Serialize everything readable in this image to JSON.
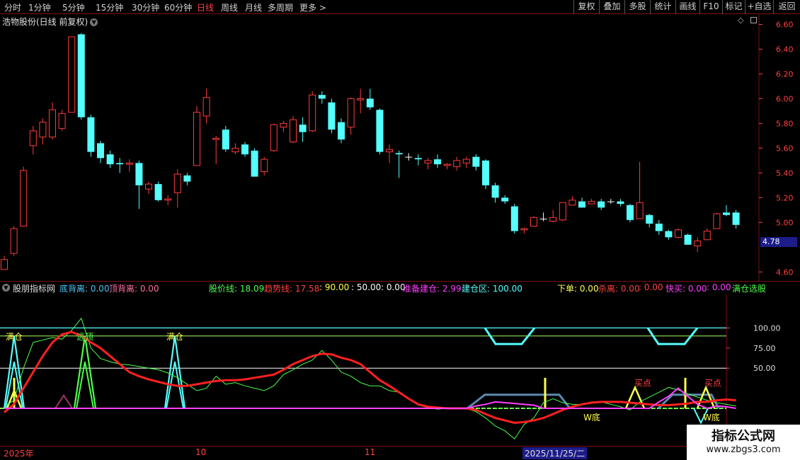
{
  "toolbar": {
    "periods": [
      "分时",
      "1分钟",
      "5分钟",
      "15分钟",
      "30分钟",
      "60分钟",
      "日线",
      "周线",
      "月线",
      "多周期",
      "更多 >"
    ],
    "active_period": "日线",
    "buttons": [
      "复权",
      "叠加",
      "多股",
      "统计",
      "画线",
      "F10",
      "标记",
      "+自选",
      "返回"
    ]
  },
  "main_chart": {
    "title": "浩物股份(日线 前复权)",
    "price_ticks": [
      "6.60",
      "6.40",
      "6.20",
      "6.00",
      "5.80",
      "5.60",
      "5.40",
      "5.20",
      "5.00",
      "4.60"
    ],
    "current_price": "4.78",
    "colors": {
      "up": "#ff3b3b",
      "down": "#54ffff",
      "flat": "#ffffff"
    }
  },
  "chart_data": [
    {
      "type": "candlestick",
      "title": "浩物股份(日线 前复权)",
      "ylim": [
        4.55,
        6.66
      ],
      "x": [
        "2025年",
        "10",
        "11",
        "2025/11/25/二"
      ],
      "candles": [
        [
          4.62,
          4.7,
          4.66,
          4.73
        ],
        [
          4.75,
          4.95,
          4.73,
          4.97
        ],
        [
          4.97,
          5.42,
          4.97,
          5.45
        ],
        [
          5.62,
          5.74,
          5.55,
          5.78
        ],
        [
          5.69,
          5.81,
          5.63,
          5.84
        ],
        [
          5.69,
          5.91,
          5.67,
          5.97
        ],
        [
          5.76,
          5.88,
          5.74,
          5.91
        ],
        [
          5.89,
          6.5,
          5.89,
          6.5
        ],
        [
          6.52,
          5.85,
          5.83,
          6.53
        ],
        [
          5.85,
          5.57,
          5.53,
          5.87
        ],
        [
          5.64,
          5.52,
          5.48,
          5.66
        ],
        [
          5.55,
          5.47,
          5.44,
          5.58
        ],
        [
          5.48,
          5.47,
          5.4,
          5.52
        ],
        [
          5.47,
          5.48,
          5.41,
          5.51
        ],
        [
          5.48,
          5.3,
          5.11,
          5.5
        ],
        [
          5.27,
          5.31,
          5.23,
          5.33
        ],
        [
          5.31,
          5.18,
          5.17,
          5.33
        ],
        [
          5.18,
          5.19,
          5.14,
          5.22
        ],
        [
          5.24,
          5.39,
          5.12,
          5.43
        ],
        [
          5.38,
          5.33,
          5.3,
          5.4
        ],
        [
          5.46,
          5.89,
          5.46,
          5.94
        ],
        [
          5.86,
          6.01,
          5.8,
          6.08
        ],
        [
          5.67,
          5.68,
          5.47,
          5.7
        ],
        [
          5.75,
          5.59,
          5.57,
          5.78
        ],
        [
          5.57,
          5.6,
          5.55,
          5.64
        ],
        [
          5.63,
          5.55,
          5.53,
          5.65
        ],
        [
          5.58,
          5.37,
          5.37,
          5.6
        ],
        [
          5.41,
          5.51,
          5.38,
          5.53
        ],
        [
          5.58,
          5.79,
          5.57,
          5.8
        ],
        [
          5.77,
          5.8,
          5.73,
          5.82
        ],
        [
          5.65,
          5.83,
          5.64,
          5.86
        ],
        [
          5.79,
          5.73,
          5.65,
          5.85
        ],
        [
          5.74,
          6.03,
          5.73,
          6.06
        ],
        [
          6.03,
          6.0,
          5.96,
          6.06
        ],
        [
          5.97,
          5.75,
          5.72,
          6.0
        ],
        [
          5.81,
          5.67,
          5.64,
          5.84
        ],
        [
          5.77,
          6.0,
          5.71,
          6.01
        ],
        [
          5.99,
          6.0,
          5.88,
          6.08
        ],
        [
          6.0,
          5.93,
          5.91,
          6.08
        ],
        [
          5.91,
          5.57,
          5.55,
          5.92
        ],
        [
          5.57,
          5.59,
          5.48,
          5.63
        ],
        [
          5.56,
          5.55,
          5.36,
          5.58
        ],
        [
          5.53,
          5.53,
          5.5,
          5.56
        ],
        [
          5.52,
          5.51,
          5.46,
          5.55
        ],
        [
          5.48,
          5.5,
          5.43,
          5.52
        ],
        [
          5.51,
          5.47,
          5.44,
          5.55
        ],
        [
          5.46,
          5.47,
          5.43,
          5.48
        ],
        [
          5.45,
          5.5,
          5.42,
          5.53
        ],
        [
          5.48,
          5.51,
          5.44,
          5.53
        ],
        [
          5.53,
          5.45,
          5.42,
          5.55
        ],
        [
          5.5,
          5.3,
          5.27,
          5.51
        ],
        [
          5.3,
          5.2,
          5.16,
          5.32
        ],
        [
          5.2,
          5.17,
          5.15,
          5.22
        ],
        [
          5.13,
          4.93,
          4.91,
          5.15
        ],
        [
          4.94,
          4.95,
          4.91,
          4.96
        ],
        [
          4.97,
          5.04,
          4.97,
          5.05
        ],
        [
          5.03,
          5.03,
          5.01,
          5.08
        ],
        [
          5.01,
          5.04,
          5.0,
          5.1
        ],
        [
          5.02,
          5.16,
          5.01,
          5.16
        ],
        [
          5.14,
          5.18,
          5.14,
          5.21
        ],
        [
          5.17,
          5.12,
          5.12,
          5.2
        ],
        [
          5.15,
          5.17,
          5.15,
          5.19
        ],
        [
          5.17,
          5.12,
          5.1,
          5.19
        ],
        [
          5.17,
          5.17,
          5.15,
          5.19
        ],
        [
          5.17,
          5.15,
          5.13,
          5.19
        ],
        [
          5.14,
          5.02,
          5.0,
          5.15
        ],
        [
          5.03,
          5.16,
          5.03,
          5.49
        ],
        [
          5.06,
          4.99,
          4.96,
          5.07
        ],
        [
          4.99,
          4.93,
          4.9,
          5.02
        ],
        [
          4.93,
          4.88,
          4.86,
          4.94
        ],
        [
          4.88,
          4.94,
          4.87,
          4.95
        ],
        [
          4.9,
          4.82,
          4.82,
          4.91
        ],
        [
          4.81,
          4.85,
          4.76,
          4.88
        ],
        [
          4.86,
          4.93,
          4.86,
          4.95
        ],
        [
          4.95,
          5.07,
          4.95,
          5.08
        ],
        [
          5.08,
          5.06,
          5.05,
          5.14
        ],
        [
          5.08,
          4.98,
          4.95,
          5.1
        ]
      ]
    },
    {
      "type": "line",
      "title": "股朋指标网",
      "ylim": [
        0,
        125
      ],
      "ticks": [
        "100.00",
        "75.00",
        "50.00"
      ],
      "series": [
        {
          "name": "股价线",
          "color": "#4cff4c",
          "values": [
            2,
            10,
            50,
            82,
            85,
            88,
            86,
            97,
            112,
            75,
            62,
            58,
            55,
            54,
            52,
            50,
            48,
            44,
            38,
            30,
            22,
            25,
            40,
            30,
            32,
            28,
            25,
            22,
            28,
            42,
            48,
            55,
            60,
            72,
            60,
            45,
            40,
            32,
            28,
            28,
            22,
            20,
            12,
            4,
            1,
            -1,
            0,
            0,
            0,
            -4,
            -12,
            -22,
            -28,
            -38,
            -20,
            -12,
            7,
            12,
            7,
            5,
            5,
            8,
            8,
            5,
            2,
            -2,
            8,
            14,
            20,
            26,
            23,
            18,
            14,
            10,
            7,
            5,
            3
          ]
        },
        {
          "name": "趋势线",
          "color": "#ff2020",
          "values": [
            -5,
            5,
            25,
            45,
            65,
            82,
            92,
            95,
            90,
            82,
            75,
            65,
            55,
            45,
            40,
            36,
            33,
            30,
            28,
            28,
            30,
            32,
            34,
            35,
            35,
            36,
            38,
            40,
            42,
            48,
            55,
            60,
            65,
            68,
            67,
            63,
            60,
            55,
            45,
            35,
            28,
            20,
            12,
            5,
            2,
            1,
            0,
            0,
            0,
            -2,
            -7,
            -12,
            -15,
            -18,
            -17,
            -15,
            -12,
            -7,
            -2,
            2,
            5,
            7,
            8,
            8,
            8,
            7,
            6,
            5,
            4,
            4,
            5,
            6,
            8,
            8,
            10,
            11,
            10
          ]
        },
        {
          "name": "准备建仓",
          "color": "#ff40ff",
          "values": [
            0,
            0,
            0,
            0,
            0,
            0,
            0,
            0,
            0,
            0,
            0,
            0,
            0,
            0,
            0,
            0,
            0,
            0,
            0,
            0,
            0,
            0,
            0,
            0,
            0,
            0,
            0,
            0,
            0,
            0,
            0,
            0,
            0,
            0,
            0,
            0,
            0,
            0,
            0,
            0,
            0,
            0,
            0,
            0,
            0,
            0,
            0,
            0,
            0,
            3,
            5,
            8,
            7,
            6,
            5,
            4,
            0,
            0,
            0,
            0,
            0,
            0,
            0,
            0,
            0,
            0,
            0,
            0,
            8,
            15,
            25,
            15,
            5,
            0,
            3,
            2,
            0
          ]
        }
      ]
    }
  ],
  "indicator": {
    "name": "股朋指标网",
    "items": [
      {
        "text": "底背离: 0.00",
        "color": "#4fc3f7"
      },
      {
        "text": "顶背离: 0.00",
        "color": "#ff6fa1"
      },
      {
        "text": "股价线: 18.09",
        "color": "#4cff4c"
      },
      {
        "text": "趋势线: 17.58",
        "color": "#ff4040"
      },
      {
        "text": ": 90.00",
        "color": "#ffff4c"
      },
      {
        "text": ": 50.00",
        "color": "#ffffff"
      },
      {
        "text": ": 0.00",
        "color": "#ffffff"
      },
      {
        "text": "准备建仓: 2.99",
        "color": "#ff40ff"
      },
      {
        "text": "建仓区: 100.00",
        "color": "#54ffff"
      },
      {
        "text": "下单: 0.00",
        "color": "#ffff4c"
      },
      {
        "text": "杀离: 0.00",
        "color": "#ff4040"
      },
      {
        "text": ": 0.00",
        "color": "#ff4040"
      },
      {
        "text": "快买: 0.00",
        "color": "#ff40ff"
      },
      {
        "text": ": 0.00",
        "color": "#ff40ff"
      },
      {
        "text": "满仓选股",
        "color": "#4cff4c"
      }
    ],
    "labels": {
      "full": "满仓",
      "escape": "逃顶",
      "buy": "买点",
      "wbottom": "W底"
    }
  },
  "footer": {
    "dates": [
      "2025年",
      "10",
      "11"
    ],
    "cursor_date": "2025/11/25/二"
  },
  "watermark": {
    "title": "指标公式网",
    "url": "www.zbgs3.com"
  }
}
